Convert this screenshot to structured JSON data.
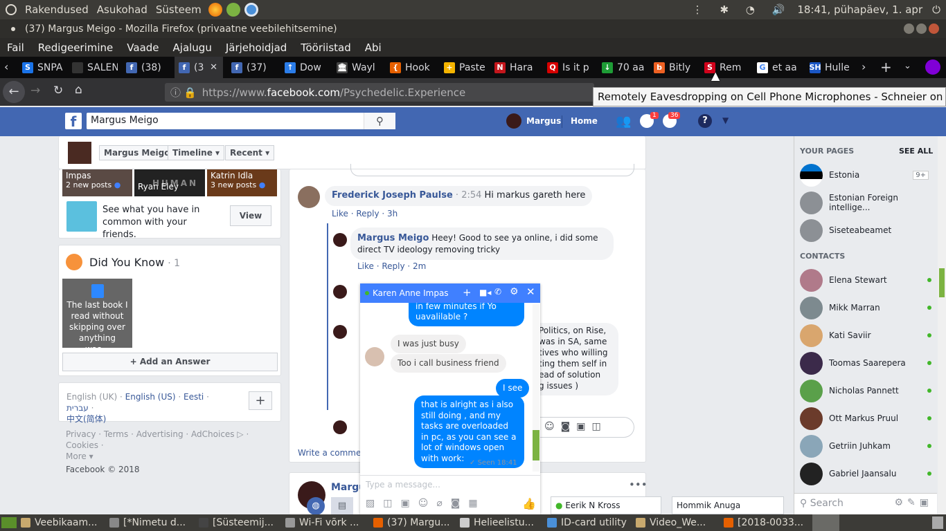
{
  "top_panel": {
    "menus": [
      "Rakendused",
      "Asukohad",
      "Süsteem"
    ],
    "clock": "18:41, pühapäev,  1. apr"
  },
  "window": {
    "title": "(37) Margus Meigo - Mozilla Firefox (privaatne veebilehitsemine)"
  },
  "menubar": [
    "Fail",
    "Redigeerimine",
    "Vaade",
    "Ajalugu",
    "Järjehoidjad",
    "Tööriistad",
    "Abi"
  ],
  "tabs": [
    {
      "label": "SNPA",
      "color": "#1a73e8",
      "icon": "S"
    },
    {
      "label": "SALENA",
      "color": "#333",
      "icon": ""
    },
    {
      "label": "(38)",
      "color": "#4267b2",
      "icon": "f"
    },
    {
      "label": "(3",
      "color": "#4267b2",
      "icon": "f"
    },
    {
      "label": "(37)",
      "color": "#4267b2",
      "icon": "f"
    },
    {
      "label": "Dow",
      "color": "#2b7de9",
      "icon": "↑"
    },
    {
      "label": "Wayl",
      "color": "#444",
      "icon": "🏛"
    },
    {
      "label": "Hook",
      "color": "#e66000",
      "icon": "{"
    },
    {
      "label": "Paste",
      "color": "#f5b400",
      "icon": "+"
    },
    {
      "label": "Hara",
      "color": "#c4161c",
      "icon": "N"
    },
    {
      "label": "Is it p",
      "color": "#d70000",
      "icon": "Q"
    },
    {
      "label": "70 aa",
      "color": "#1e9c36",
      "icon": "↓"
    },
    {
      "label": "Bitly",
      "color": "#ee6123",
      "icon": "b"
    },
    {
      "label": "Rem",
      "color": "#d0021b",
      "icon": "S"
    },
    {
      "label": "et aa",
      "color": "#fff",
      "icon": "G"
    },
    {
      "label": "Hulle",
      "color": "#1a56c4",
      "icon": "SH"
    }
  ],
  "url": {
    "prefix": "https://www.",
    "domain": "facebook.com",
    "path": "/Psychedelic.Experience"
  },
  "tooltip": "Remotely Eavesdropping on Cell Phone Microphones - Schneier on Security",
  "fb": {
    "search_value": "Margus Meigo",
    "user": "Margus",
    "home": "Home",
    "messages_badge": "1",
    "notif_badge": "36",
    "profile_bar": {
      "name": "Margus Meigo",
      "timeline": "Timeline",
      "recent": "Recent"
    },
    "friends": [
      {
        "name": "Impas",
        "posts": "2 new posts"
      },
      {
        "name": "Ryan Eley",
        "posts": ""
      },
      {
        "name": "Katrin Idla",
        "posts": "3 new posts"
      }
    ],
    "friends_overlay": "HUMAN",
    "common": {
      "text": "See what you have in common with your friends.",
      "button": "View"
    },
    "did_you_know": {
      "title": "Did You Know",
      "count": "· 1",
      "card": "The last book I read without skipping over anything was...",
      "add": "Add an Answer"
    },
    "languages": {
      "current": "English (UK)",
      "sep": " · ",
      "others": [
        "English (US)",
        "Eesti",
        "עברית",
        "中文(简体)"
      ]
    },
    "footer_links": [
      "Privacy",
      "Terms",
      "Advertising",
      "AdChoices",
      "Cookies",
      "More"
    ],
    "copyright": "Facebook © 2018",
    "comments": [
      {
        "author": "Frederick Joseph Paulse",
        "time": "2:54",
        "text": "Hi markus gareth here",
        "actions": "Like · Reply · 3h"
      },
      {
        "author": "Margus Meigo",
        "text": "Heey! Good to see ya online, i did some direct TV ideology removing tricky",
        "actions": "Like · Reply · 2m"
      }
    ],
    "partial_comment_lines": [
      "Politics, on Rise,",
      "was in SA, same",
      "tives who willing",
      "ting them self in",
      "ead of solution",
      "g issues )"
    ],
    "write_comment": "Write a comment",
    "post_author": "Margus",
    "side": {
      "your_pages": "YOUR PAGES",
      "see_all": "SEE ALL",
      "pages": [
        {
          "name": "Estonia",
          "badge": "9+"
        },
        {
          "name": "Estonian Foreign intellige..."
        },
        {
          "name": "Siseteabeamet"
        }
      ],
      "contacts_label": "CONTACTS",
      "contacts": [
        {
          "name": "Elena Stewart",
          "color": "#b07a8a"
        },
        {
          "name": "Mikk Marran",
          "color": "#7d8a8f"
        },
        {
          "name": "Kati Saviir",
          "color": "#d9a66e"
        },
        {
          "name": "Toomas Saarepera",
          "color": "#3b2a4a"
        },
        {
          "name": "Nicholas Pannett",
          "color": "#5aa04a"
        },
        {
          "name": "Ott Markus Pruul",
          "color": "#6b3b2b"
        },
        {
          "name": "Getriin Juhkam",
          "color": "#8aa6b8"
        },
        {
          "name": "Gabriel Jaansalu",
          "color": "#222"
        }
      ],
      "search_placeholder": "Search"
    },
    "chat": {
      "name": "Karen Anne Impas",
      "messages": [
        {
          "dir": "out",
          "text": "in few minutes if Yo uavalilable ?"
        },
        {
          "dir": "in",
          "text": "I was just busy"
        },
        {
          "dir": "in",
          "text": "Too i call business friend"
        },
        {
          "dir": "out",
          "text": "I see"
        },
        {
          "dir": "out",
          "text": "that is alright as i also still doing , and my tasks are overloaded in pc, as you can see a lot of windows open with work:"
        }
      ],
      "seen": "Seen 18:41",
      "placeholder": "Type a message..."
    },
    "bottom_chat_tabs": [
      "Eerik N Kross",
      "Hommik Anuga"
    ]
  },
  "taskbar": [
    "Veebikaam...",
    "[*Nimetu d...",
    "[Süsteemij...",
    "Wi-Fi võrk ...",
    "(37) Margu...",
    "Helieelistu...",
    "ID-card utility",
    "Video_We...",
    "[2018-0033..."
  ]
}
